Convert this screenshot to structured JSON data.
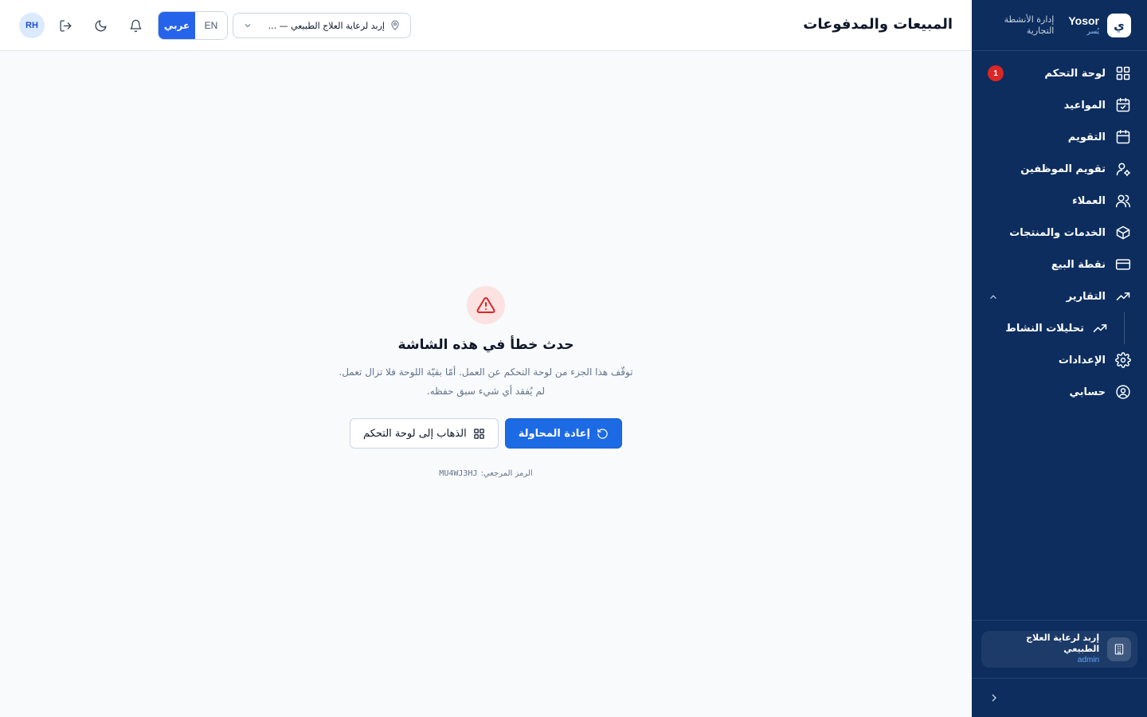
{
  "brand": {
    "name_en": "Yosor",
    "name_ar": "يُسر",
    "logo_glyph": "ي",
    "tagline_line1": "إدارة الأنشطة",
    "tagline_line2": "التجارية"
  },
  "sidebar": {
    "items": [
      {
        "label": "لوحة التحكم",
        "icon": "dashboard-grid-icon",
        "badge": "1"
      },
      {
        "label": "المواعيد",
        "icon": "calendar-check-icon"
      },
      {
        "label": "التقويم",
        "icon": "calendar-icon"
      },
      {
        "label": "تقويم الموظفين",
        "icon": "user-gear-icon"
      },
      {
        "label": "العملاء",
        "icon": "users-icon"
      },
      {
        "label": "الخدمات والمنتجات",
        "icon": "box-icon"
      },
      {
        "label": "نقطة البيع",
        "icon": "credit-card-icon"
      },
      {
        "label": "التقارير",
        "icon": "trending-up-icon",
        "expanded": true
      },
      {
        "label": "الإعدادات",
        "icon": "gear-icon"
      },
      {
        "label": "حسابي",
        "icon": "user-circle-icon"
      }
    ],
    "sub_items": [
      {
        "label": "تحليلات النشاط",
        "icon": "trending-up-icon"
      }
    ],
    "org": {
      "name": "إربد لرعاية العلاج الطبيعي",
      "role": "admin"
    }
  },
  "header": {
    "title": "المبيعات والمدفوعات",
    "branch": "إربد لرعاية العلاج الطبيعي — ...",
    "lang_en": "EN",
    "lang_ar": "عربي",
    "active_lang": "ar",
    "avatar": "RH"
  },
  "error": {
    "title": "حدث خطأ في هذه الشاشة",
    "desc_line1": "توقّف هذا الجزء من لوحة التحكم عن العمل. أمّا بقيّة اللوحة فلا تزال تعمل.",
    "desc_line2": "لم يُفقد أي شيء سبق حفظه.",
    "retry_label": "إعادة المحاولة",
    "dashboard_label": "الذهاب إلى لوحة التحكم",
    "ref_label": "الرمز المرجعي:",
    "ref_code": "MU4WJ3HJ"
  },
  "colors": {
    "sidebar_bg": "#0c2d5e",
    "primary": "#1d6ae5",
    "danger": "#dc2626",
    "page_bg": "#f8fafc"
  }
}
